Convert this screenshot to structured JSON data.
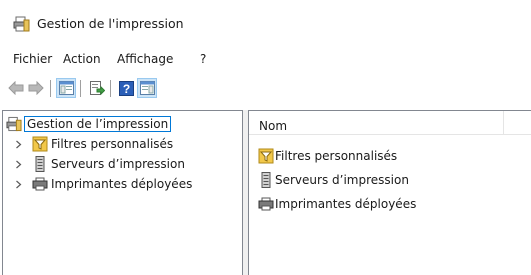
{
  "window": {
    "title": "Gestion de l'impression"
  },
  "menu": {
    "items": [
      "Fichier",
      "Action",
      "Affichage",
      "?"
    ]
  },
  "toolbar": {
    "buttons": [
      "back-arrow-icon",
      "forward-arrow-icon",
      "show-hide-console-tree-icon",
      "export-list-icon",
      "help-icon",
      "show-hide-action-pane-icon"
    ]
  },
  "tree": {
    "root": "Gestion de l’impression",
    "children": [
      "Filtres personnalisés",
      "Serveurs d’impression",
      "Imprimantes déployées"
    ]
  },
  "list": {
    "column_header": "Nom",
    "items": [
      "Filtres personnalisés",
      "Serveurs d’impression",
      "Imprimantes déployées"
    ]
  },
  "colors": {
    "selection_outline": "#0078d7",
    "toolbar_active": "#cce4f7",
    "pane_border": "#828790"
  }
}
